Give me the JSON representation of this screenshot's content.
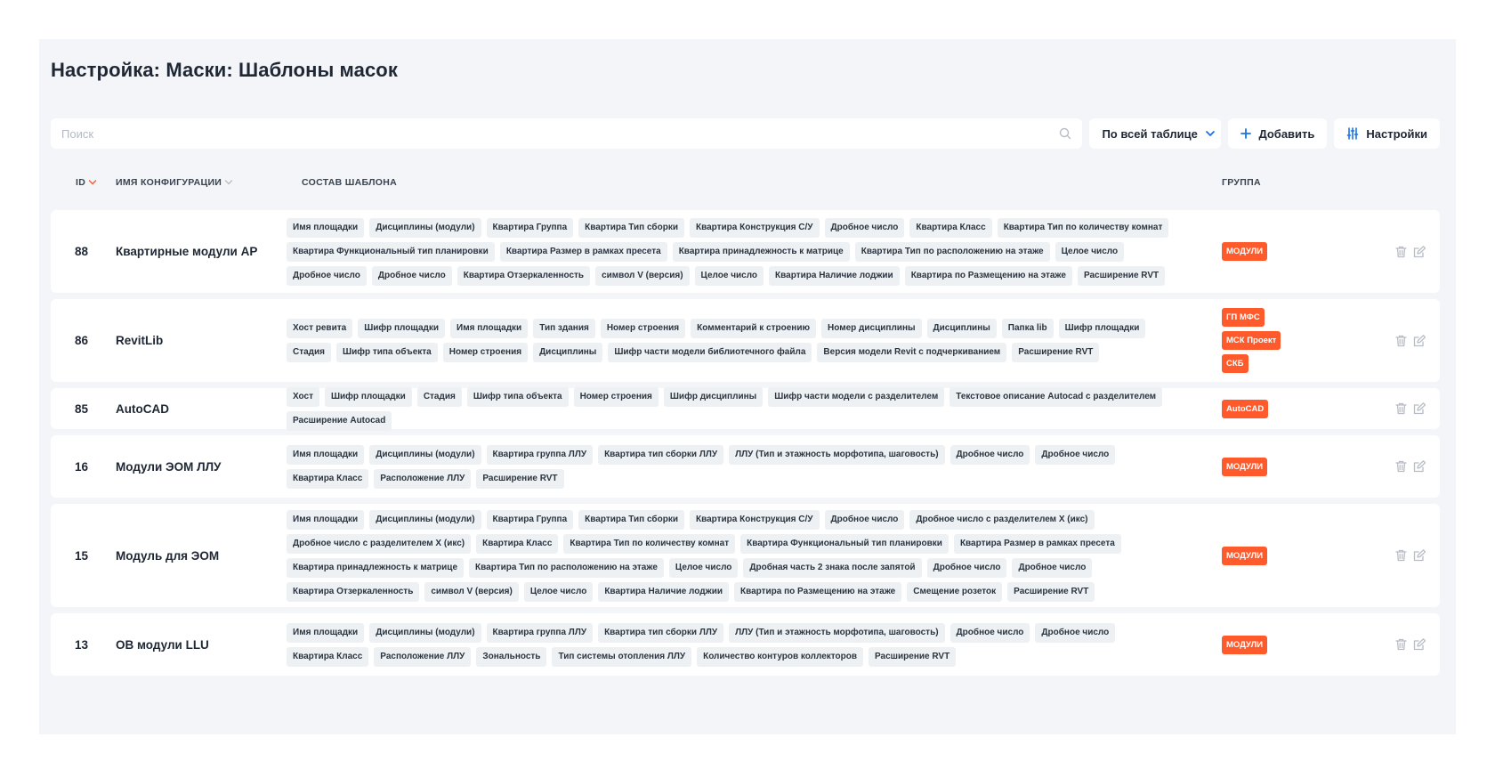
{
  "page": {
    "title": "Настройка: Маски: Шаблоны масок"
  },
  "toolbar": {
    "search_placeholder": "Поиск",
    "scope_label": "По всей таблице",
    "add_label": "Добавить",
    "settings_label": "Настройки"
  },
  "columns": {
    "id": "ID",
    "name": "ИМЯ КОНФИГУРАЦИИ",
    "composition": "СОСТАВ ШАБЛОНА",
    "group": "ГРУППА"
  },
  "colors": {
    "accent": "#ff5a2c",
    "tag_bg": "#eef1f4",
    "panel_bg": "#f3f5f8",
    "action_icon": "#b7bdc6"
  },
  "icons": [
    "search-icon",
    "chevron-down-icon",
    "plus-icon",
    "sliders-icon",
    "sort-desc-icon",
    "sort-icon",
    "trash-icon",
    "edit-icon"
  ],
  "rows": [
    {
      "id": "88",
      "name": "Квартирные модули АР",
      "tags": [
        "Имя площадки",
        "Дисциплины (модули)",
        "Квартира Группа",
        "Квартира Тип сборки",
        "Квартира Конструкция С/У",
        "Дробное число",
        "Квартира Класс",
        "Квартира Тип по количеству комнат",
        "Квартира Функциональный тип планировки",
        "Квартира Размер в рамках пресета",
        "Квартира принадлежность к матрице",
        "Квартира Тип по расположению на этаже",
        "Целое число",
        "Дробное число",
        "Дробное число",
        "Квартира Отзеркаленность",
        "символ V (версия)",
        "Целое число",
        "Квартира Наличие лоджии",
        "Квартира по Размещению на этаже",
        "Расширение RVT"
      ],
      "groups": [
        "МОДУЛИ"
      ]
    },
    {
      "id": "86",
      "name": "RevitLib",
      "tags": [
        "Хост ревита",
        "Шифр площадки",
        "Имя площадки",
        "Тип здания",
        "Номер строения",
        "Комментарий к строению",
        "Номер дисциплины",
        "Дисциплины",
        "Папка lib",
        "Шифр площадки",
        "Стадия",
        "Шифр типа объекта",
        "Номер строения",
        "Дисциплины",
        "Шифр части модели библиотечного файла",
        "Версия модели Revit с подчеркиванием",
        "Расширение RVT"
      ],
      "groups": [
        "ГП МФС",
        "МСК Проект",
        "СКБ"
      ]
    },
    {
      "id": "85",
      "name": "AutoCAD",
      "tags": [
        "Хост",
        "Шифр площадки",
        "Стадия",
        "Шифр типа объекта",
        "Номер строения",
        "Шифр дисциплины",
        "Шифр части модели с разделителем",
        "Текстовое описание Autocad с разделителем",
        "Расширение Autocad"
      ],
      "groups": [
        "AutoCAD"
      ]
    },
    {
      "id": "16",
      "name": "Модули ЭОМ ЛЛУ",
      "tags": [
        "Имя площадки",
        "Дисциплины (модули)",
        "Квартира группа ЛЛУ",
        "Квартира тип сборки ЛЛУ",
        "ЛЛУ (Тип и этажность морфотипа, шаговость)",
        "Дробное число",
        "Дробное число",
        "Квартира Класс",
        "Расположение ЛЛУ",
        "Расширение RVT"
      ],
      "groups": [
        "МОДУЛИ"
      ]
    },
    {
      "id": "15",
      "name": "Модуль для ЭОМ",
      "tags": [
        "Имя площадки",
        "Дисциплины (модули)",
        "Квартира Группа",
        "Квартира Тип сборки",
        "Квартира Конструкция С/У",
        "Дробное число",
        "Дробное число с разделителем Х (икс)",
        "Дробное число с разделителем Х (икс)",
        "Квартира Класс",
        "Квартира Тип по количеству комнат",
        "Квартира Функциональный тип планировки",
        "Квартира Размер в рамках пресета",
        "Квартира принадлежность к матрице",
        "Квартира Тип по расположению на этаже",
        "Целое число",
        "Дробная часть 2 знака после запятой",
        "Дробное число",
        "Дробное число",
        "Квартира Отзеркаленность",
        "символ V (версия)",
        "Целое число",
        "Квартира Наличие лоджии",
        "Квартира по Размещению на этаже",
        "Смещение розеток",
        "Расширение RVT"
      ],
      "groups": [
        "МОДУЛИ"
      ]
    },
    {
      "id": "13",
      "name": "ОВ модули LLU",
      "tags": [
        "Имя площадки",
        "Дисциплины (модули)",
        "Квартира группа ЛЛУ",
        "Квартира тип сборки ЛЛУ",
        "ЛЛУ (Тип и этажность морфотипа, шаговость)",
        "Дробное число",
        "Дробное число",
        "Квартира Класс",
        "Расположение ЛЛУ",
        "Зональность",
        "Тип системы отопления ЛЛУ",
        "Количество контуров коллекторов",
        "Расширение RVT"
      ],
      "groups": [
        "МОДУЛИ"
      ]
    }
  ]
}
